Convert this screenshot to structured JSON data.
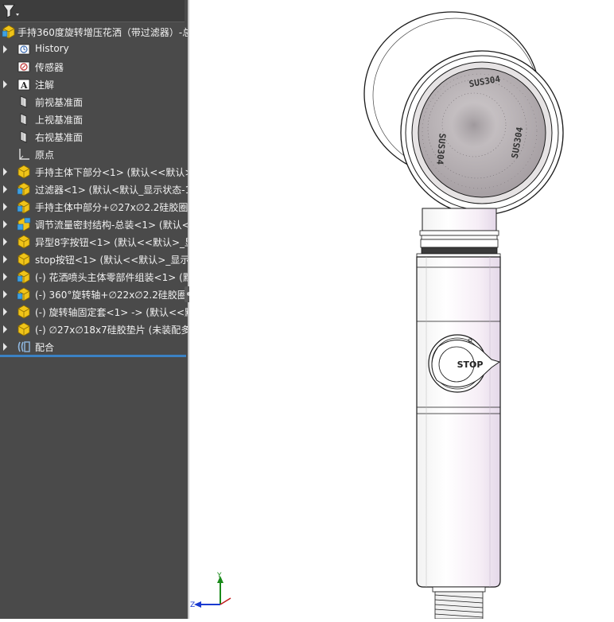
{
  "feature_tree": {
    "root": {
      "label": "手持360度旋转增压花洒（带过滤器）-总"
    },
    "items": [
      {
        "label": "History",
        "icon": "history-icon",
        "expandable": true
      },
      {
        "label": "传感器",
        "icon": "sensor-icon",
        "expandable": false
      },
      {
        "label": "注解",
        "icon": "annotation-icon",
        "expandable": true
      },
      {
        "label": "前视基准面",
        "icon": "plane-icon",
        "expandable": false
      },
      {
        "label": "上视基准面",
        "icon": "plane-icon",
        "expandable": false
      },
      {
        "label": "右视基准面",
        "icon": "plane-icon",
        "expandable": false
      },
      {
        "label": "原点",
        "icon": "origin-icon",
        "expandable": false
      },
      {
        "label": "手持主体下部分<1> (默认<<默认>",
        "icon": "part-icon",
        "expandable": true
      },
      {
        "label": "过滤器<1> (默认<默认_显示状态-1",
        "icon": "assembly-icon",
        "expandable": true
      },
      {
        "label": "手持主体中部分+∅27x∅2.2硅胶圈",
        "icon": "assembly-icon",
        "expandable": true
      },
      {
        "label": "调节流量密封结构-总装<1> (默认<",
        "icon": "subassembly-icon",
        "expandable": true
      },
      {
        "label": "异型8字按钮<1> (默认<<默认>_显",
        "icon": "part-icon",
        "expandable": true
      },
      {
        "label": "stop按钮<1> (默认<<默认>_显示",
        "icon": "part-icon",
        "expandable": true
      },
      {
        "label": "(-) 花洒喷头主体零部件组装<1> (默",
        "icon": "assembly-icon",
        "expandable": true
      },
      {
        "label": "(-) 360°旋转轴+∅22x∅2.2硅胶圈<",
        "icon": "assembly-icon",
        "expandable": true
      },
      {
        "label": "(-) 旋转轴固定套<1> -> (默认<<默",
        "icon": "part-icon",
        "expandable": true
      },
      {
        "label": "(-) ∅27x∅18x7硅胶垫片 (未装配多",
        "icon": "part-icon",
        "expandable": true
      },
      {
        "label": "配合",
        "icon": "mates-icon",
        "expandable": true
      }
    ]
  },
  "model": {
    "face_text_top": "SUS304",
    "face_text_left": "SUS304",
    "face_text_right": "SUS304",
    "button_label": "STOP"
  },
  "triad": {
    "y": "Y",
    "z": "Z"
  },
  "colors": {
    "panel_bg": "#4a4a4a",
    "accent": "#3b82c4",
    "viewport_bg": "#ffffff"
  }
}
